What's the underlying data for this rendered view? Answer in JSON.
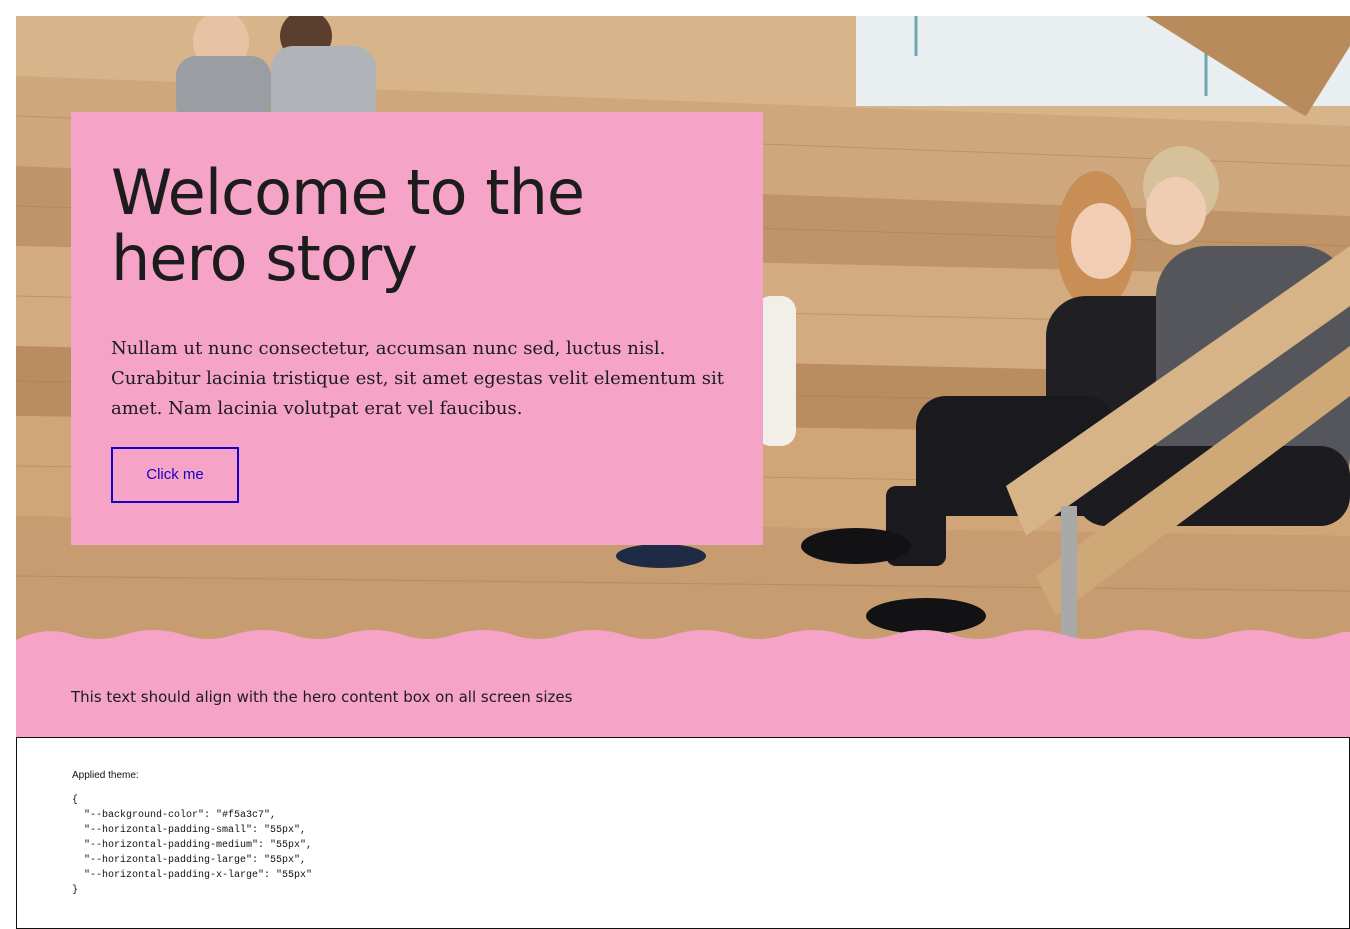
{
  "hero": {
    "title": "Welcome to the hero story",
    "body": "Nullam ut nunc consectetur, accumsan nunc sed, luctus nisl. Curabitur lacinia tristique est, sit amet egestas velit elementum sit amet. Nam lacinia volutpat erat vel faucibus.",
    "button_label": "Click me"
  },
  "band": {
    "text": "This text should align with the hero content box on all screen sizes"
  },
  "theme": {
    "label": "Applied theme:",
    "code": "{\n  \"--background-color\": \"#f5a3c7\",\n  \"--horizontal-padding-small\": \"55px\",\n  \"--horizontal-padding-medium\": \"55px\",\n  \"--horizontal-padding-large\": \"55px\",\n  \"--horizontal-padding-x-large\": \"55px\"\n}"
  },
  "colors": {
    "background": "#f5a3c7",
    "button": "#1a00c8",
    "text": "#1c1c1c"
  }
}
